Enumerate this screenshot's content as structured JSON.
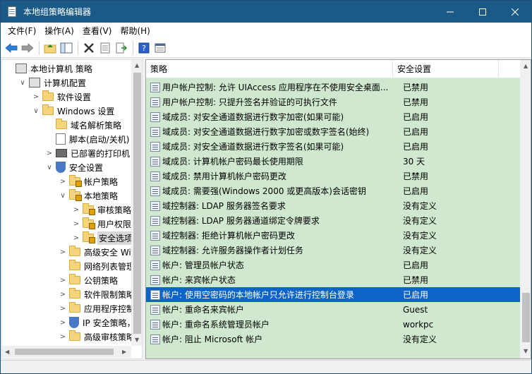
{
  "window": {
    "title": "本地组策略编辑器"
  },
  "menu": [
    "文件(F)",
    "操作(A)",
    "查看(V)",
    "帮助(H)"
  ],
  "tree": [
    {
      "label": "本地计算机 策略",
      "level": 0,
      "expander": "",
      "icon": "computer-icon"
    },
    {
      "label": "计算机配置",
      "level": 1,
      "expander": "∨",
      "icon": "computer-icon"
    },
    {
      "label": "软件设置",
      "level": 2,
      "expander": ">",
      "icon": "folder-icon"
    },
    {
      "label": "Windows 设置",
      "level": 2,
      "expander": "∨",
      "icon": "folder-icon"
    },
    {
      "label": "域名解析策略",
      "level": 3,
      "expander": "",
      "icon": "folder-icon"
    },
    {
      "label": "脚本(启动/关机)",
      "level": 3,
      "expander": "",
      "icon": "document-icon"
    },
    {
      "label": "已部署的打印机",
      "level": 3,
      "expander": ">",
      "icon": "printer-icon"
    },
    {
      "label": "安全设置",
      "level": 3,
      "expander": "∨",
      "icon": "shield-icon"
    },
    {
      "label": "帐户策略",
      "level": 4,
      "expander": ">",
      "icon": "lock-folder-icon"
    },
    {
      "label": "本地策略",
      "level": 4,
      "expander": "∨",
      "icon": "lock-folder-icon"
    },
    {
      "label": "审核策略",
      "level": 5,
      "expander": ">",
      "icon": "lock-folder-icon"
    },
    {
      "label": "用户权限分",
      "level": 5,
      "expander": ">",
      "icon": "lock-folder-icon"
    },
    {
      "label": "安全选项",
      "level": 5,
      "expander": ">",
      "icon": "lock-folder-icon",
      "selected": true
    },
    {
      "label": "高级安全 Wind",
      "level": 4,
      "expander": ">",
      "icon": "folder-icon"
    },
    {
      "label": "网络列表管理器",
      "level": 4,
      "expander": "",
      "icon": "folder-icon"
    },
    {
      "label": "公钥策略",
      "level": 4,
      "expander": ">",
      "icon": "folder-icon"
    },
    {
      "label": "软件限制策略",
      "level": 4,
      "expander": ">",
      "icon": "folder-icon"
    },
    {
      "label": "应用程序控制策",
      "level": 4,
      "expander": ">",
      "icon": "folder-icon"
    },
    {
      "label": "IP 安全策略，在",
      "level": 4,
      "expander": ">",
      "icon": "shield-icon"
    },
    {
      "label": "高级审核策略配",
      "level": 4,
      "expander": ">",
      "icon": "folder-icon"
    }
  ],
  "table": {
    "headers": [
      "策略",
      "安全设置"
    ],
    "rows": [
      {
        "policy": "用户帐户控制: 允许 UIAccess 应用程序在不使用安全桌面...",
        "setting": "已禁用"
      },
      {
        "policy": "用户帐户控制: 只提升签名并验证的可执行文件",
        "setting": "已禁用"
      },
      {
        "policy": "域成员: 对安全通道数据进行数字加密(如果可能)",
        "setting": "已启用"
      },
      {
        "policy": "域成员: 对安全通道数据进行数字加密或数字签名(始终)",
        "setting": "已启用"
      },
      {
        "policy": "域成员: 对安全通道数据进行数字签名(如果可能)",
        "setting": "已启用"
      },
      {
        "policy": "域成员: 计算机帐户密码最长使用期限",
        "setting": "30 天"
      },
      {
        "policy": "域成员: 禁用计算机帐户密码更改",
        "setting": "已禁用"
      },
      {
        "policy": "域成员: 需要强(Windows 2000 或更高版本)会话密钥",
        "setting": "已启用"
      },
      {
        "policy": "域控制器: LDAP 服务器签名要求",
        "setting": "没有定义"
      },
      {
        "policy": "域控制器: LDAP 服务器通道绑定令牌要求",
        "setting": "没有定义"
      },
      {
        "policy": "域控制器: 拒绝计算机帐户密码更改",
        "setting": "没有定义"
      },
      {
        "policy": "域控制器: 允许服务器操作者计划任务",
        "setting": "没有定义"
      },
      {
        "policy": "帐户: 管理员帐户状态",
        "setting": "已启用"
      },
      {
        "policy": "帐户: 来宾帐户状态",
        "setting": "已禁用"
      },
      {
        "policy": "帐户: 使用空密码的本地帐户只允许进行控制台登录",
        "setting": "已启用",
        "selected": true
      },
      {
        "policy": "帐户: 重命名来宾帐户",
        "setting": "Guest"
      },
      {
        "policy": "帐户: 重命名系统管理员帐户",
        "setting": "workpc"
      },
      {
        "policy": "帐户: 阻止 Microsoft 帐户",
        "setting": "没有定义"
      }
    ]
  },
  "colors": {
    "titlebar": "#1b5a86",
    "selection": "#0c64c8",
    "pane": "#cfe8cf"
  }
}
